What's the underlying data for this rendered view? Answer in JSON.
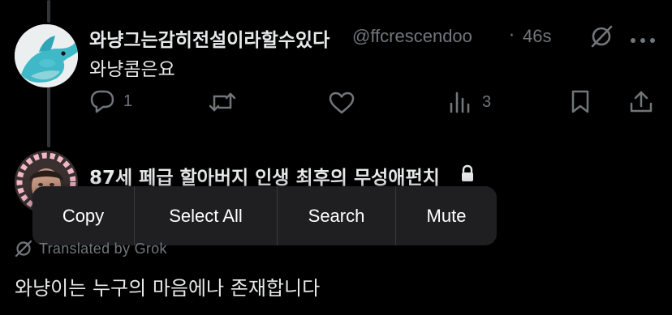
{
  "post": {
    "display_name": "와냥그는감히전설이라할수있다",
    "handle": "@ffcrescendoo",
    "separator": "·",
    "time": "46s",
    "text": "와냥콤은요",
    "reply_count": "1",
    "retweet_count": "",
    "like_count": "",
    "views_count": "3",
    "top_icons": [
      "grok-translate-icon",
      "more-icon"
    ],
    "avatar_icon": "dolphin-plush-avatar"
  },
  "quoted": {
    "display_name": "87세 페급 할아버지 인생 최후의 무성애펀치",
    "lock_icon": "lock-icon",
    "avatar_icon": "heart-frame-avatar"
  },
  "context_menu": {
    "items": [
      "Copy",
      "Select All",
      "Search",
      "Mute"
    ]
  },
  "translation": {
    "label": "Translated by Grok",
    "icon": "grok-icon",
    "text": "와냥이는 누구의 마음에나 존재합니다"
  },
  "colors": {
    "background": "#000000",
    "text_primary": "#e7e9ea",
    "text_secondary": "#71767b",
    "menu_bg": "#1f1f22"
  }
}
